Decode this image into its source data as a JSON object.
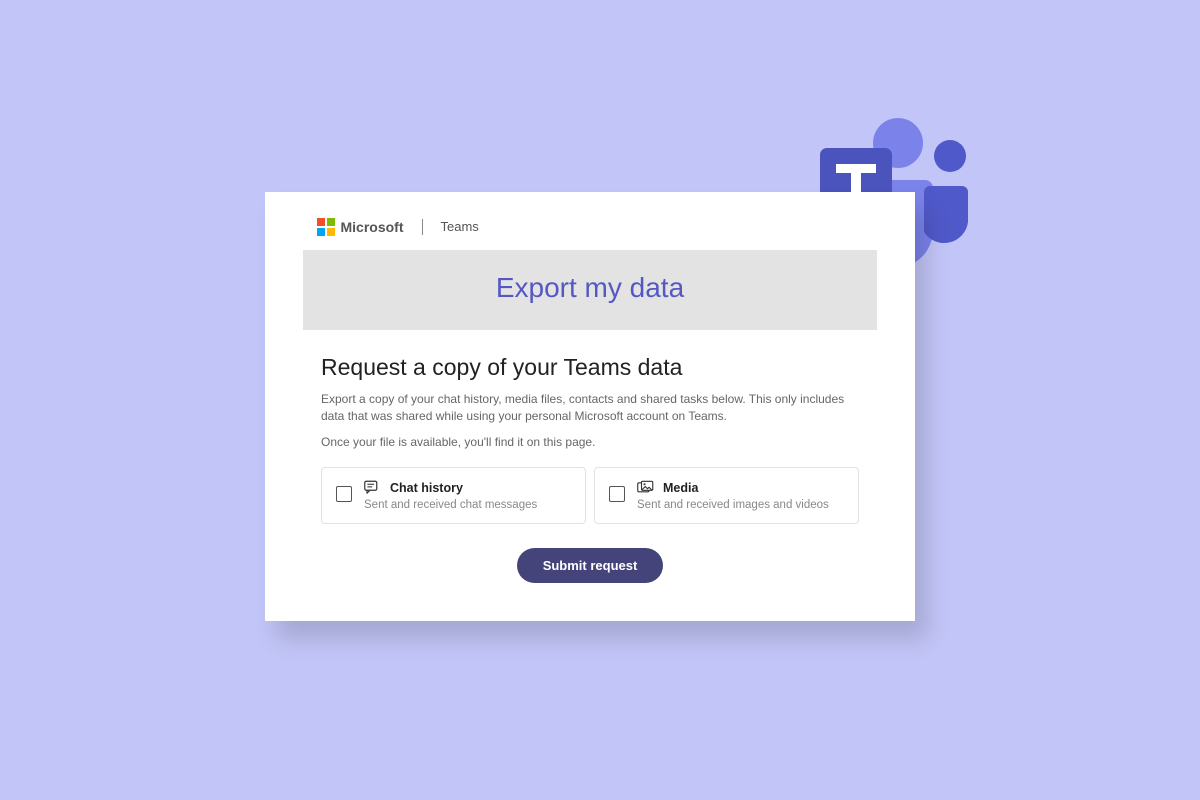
{
  "header": {
    "brand": "Microsoft",
    "product": "Teams"
  },
  "banner": {
    "title": "Export my data"
  },
  "main": {
    "subtitle": "Request a copy of your Teams data",
    "description": "Export a copy of your chat history, media files, contacts and shared tasks below. This only includes data that was shared while using your personal Microsoft account on Teams.",
    "availability_note": "Once your file is available, you'll find it on this page."
  },
  "options": [
    {
      "title": "Chat history",
      "subtitle": "Sent and received chat messages"
    },
    {
      "title": "Media",
      "subtitle": "Sent and received images and videos"
    }
  ],
  "actions": {
    "submit_label": "Submit request"
  }
}
